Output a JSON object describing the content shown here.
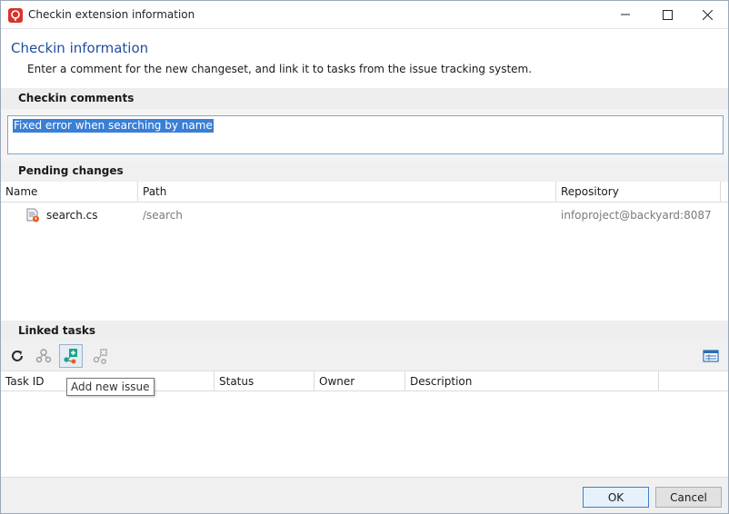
{
  "window": {
    "title": "Checkin extension information"
  },
  "header": {
    "title": "Checkin information",
    "subtitle": "Enter a comment for the new changeset, and link it to tasks from the issue tracking system."
  },
  "comments": {
    "section_label": "Checkin comments",
    "value": "Fixed error when searching by name"
  },
  "pending": {
    "section_label": "Pending changes",
    "columns": [
      "Name",
      "Path",
      "Repository"
    ],
    "rows": [
      {
        "name": "search.cs",
        "path": "/search",
        "repository": "infoproject@backyard:8087"
      }
    ]
  },
  "linked": {
    "section_label": "Linked tasks",
    "toolbar": {
      "refresh_icon": "refresh-icon",
      "link_icon": "link-task-icon",
      "add_icon": "add-issue-icon",
      "remove_icon": "remove-link-icon",
      "view_icon": "table-view-icon"
    },
    "tooltip": "Add new issue",
    "columns": [
      "Task ID",
      "Status",
      "Owner",
      "Description"
    ]
  },
  "footer": {
    "ok_label": "OK",
    "cancel_label": "Cancel"
  },
  "colors": {
    "accent": "#1f4e9c",
    "selection": "#3a7fd6",
    "app_icon": "#d9342b"
  }
}
